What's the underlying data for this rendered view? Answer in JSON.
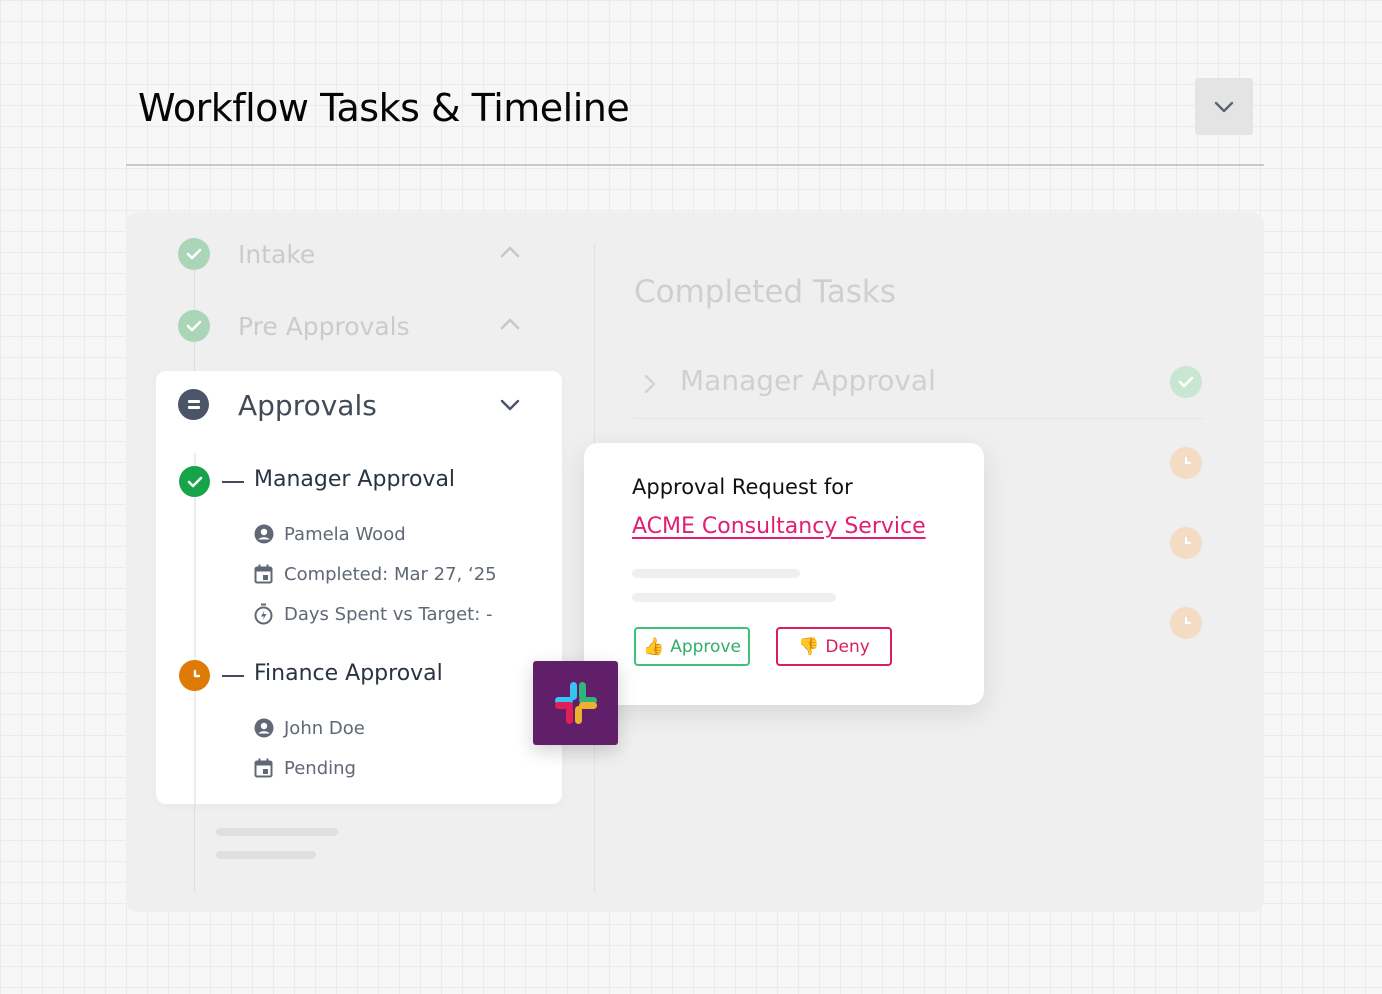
{
  "header": {
    "title": "Workflow Tasks & Timeline",
    "dropdown_icon": "chevron-down-icon"
  },
  "stages": [
    {
      "label": "Intake",
      "status": "completed",
      "expanded": false
    },
    {
      "label": "Pre Approvals",
      "status": "completed",
      "expanded": false
    },
    {
      "label": "Approvals",
      "status": "in-progress",
      "expanded": true
    }
  ],
  "approvals": {
    "tasks": [
      {
        "name": "Manager Approval",
        "status": "completed",
        "assignee": "Pamela Wood",
        "date_text": "Completed: Mar 27, ‘25",
        "days_text": "Days Spent vs Target: -"
      },
      {
        "name": "Finance Approval",
        "status": "pending",
        "assignee": "John Doe",
        "date_text": "Pending"
      }
    ]
  },
  "completed_tasks": {
    "title": "Completed Tasks",
    "items": [
      {
        "label": "Manager Approval",
        "status": "completed"
      },
      {
        "label": "",
        "status": "pending"
      },
      {
        "label": "",
        "status": "pending"
      },
      {
        "label": "",
        "status": "pending"
      }
    ]
  },
  "request_card": {
    "title": "Approval Request for",
    "link_text": "ACME Consultancy Service",
    "approve_label": "Approve",
    "approve_emoji": "👍",
    "deny_label": "Deny",
    "deny_emoji": "👎"
  },
  "integration": {
    "name": "Slack",
    "icon": "slack-logo-icon"
  },
  "colors": {
    "success": "#16a34a",
    "pending": "#de7a06",
    "link": "#e11d74",
    "approve": "#3ec27a",
    "deny": "#d91f5b",
    "slack_bg": "#611f69"
  }
}
